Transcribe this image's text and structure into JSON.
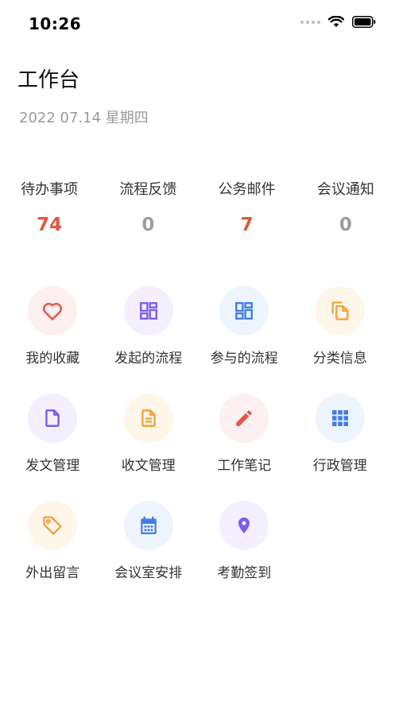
{
  "status": {
    "time": "10:26"
  },
  "header": {
    "title": "工作台",
    "date": "2022 07.14 星期四"
  },
  "stats": [
    {
      "label": "待办事项",
      "value": "74",
      "color": "#e2563e"
    },
    {
      "label": "流程反馈",
      "value": "0",
      "color": "#9e9e9e"
    },
    {
      "label": "公务邮件",
      "value": "7",
      "color": "#e2563e"
    },
    {
      "label": "会议通知",
      "value": "0",
      "color": "#9e9e9e"
    }
  ],
  "apps": [
    {
      "label": "我的收藏",
      "icon": "heart-icon",
      "color": "#e2564b",
      "bg": "#fcefef"
    },
    {
      "label": "发起的流程",
      "icon": "dashboard-icon",
      "color": "#7c5ce6",
      "bg": "#f3efff"
    },
    {
      "label": "参与的流程",
      "icon": "dashboard-icon",
      "color": "#3f7de5",
      "bg": "#eef4fd"
    },
    {
      "label": "分类信息",
      "icon": "copy-icon",
      "color": "#f2a13a",
      "bg": "#fff6ea"
    },
    {
      "label": "发文管理",
      "icon": "document-icon",
      "color": "#7c5ce6",
      "bg": "#f3efff"
    },
    {
      "label": "收文管理",
      "icon": "text-document-icon",
      "color": "#f2a13a",
      "bg": "#fff6ea"
    },
    {
      "label": "工作笔记",
      "icon": "pencil-icon",
      "color": "#e2564b",
      "bg": "#fcefef"
    },
    {
      "label": "行政管理",
      "icon": "apps-grid-icon",
      "color": "#3f7de5",
      "bg": "#eef4fd"
    },
    {
      "label": "外出留言",
      "icon": "tag-icon",
      "color": "#f2a13a",
      "bg": "#fff6ea"
    },
    {
      "label": "会议室安排",
      "icon": "calendar-icon",
      "color": "#3f7de5",
      "bg": "#eef4fd"
    },
    {
      "label": "考勤签到",
      "icon": "location-pin-icon",
      "color": "#7c5ce6",
      "bg": "#f3efff"
    }
  ]
}
